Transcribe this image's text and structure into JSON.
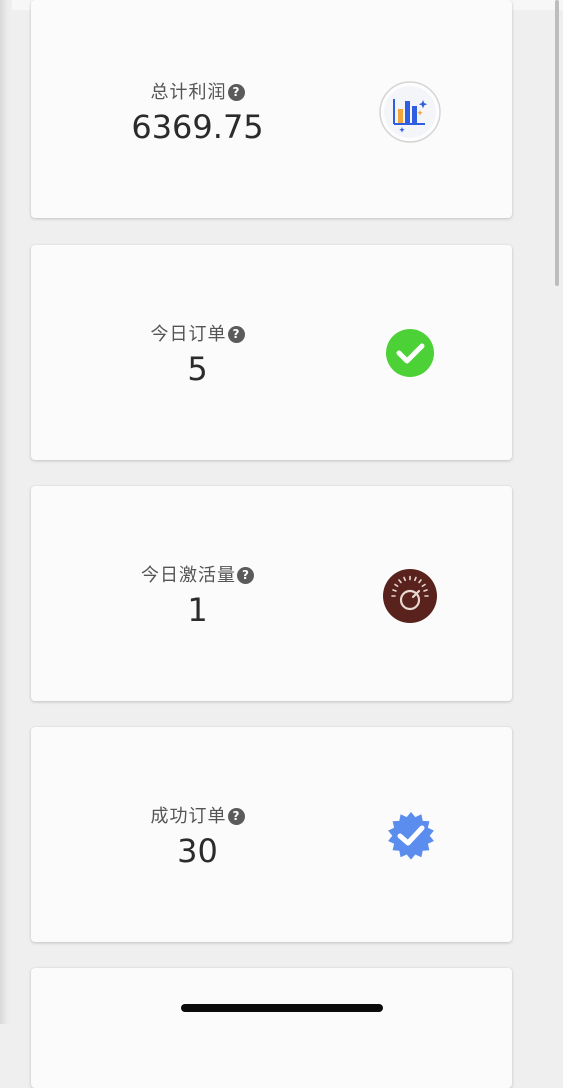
{
  "cards": [
    {
      "label": "总计利润",
      "value": "6369.75",
      "icon": "bar-chart-icon"
    },
    {
      "label": "今日订单",
      "value": "5",
      "icon": "check-circle-icon"
    },
    {
      "label": "今日激活量",
      "value": "1",
      "icon": "power-dial-icon"
    },
    {
      "label": "成功订单",
      "value": "30",
      "icon": "verified-badge-icon"
    }
  ],
  "help_glyph": "?",
  "colors": {
    "check_green": "#4cd137",
    "dial_brown": "#5a221d",
    "badge_blue": "#5b8def",
    "chart_orange": "#f3a43b",
    "chart_blue": "#2f5fe0"
  }
}
